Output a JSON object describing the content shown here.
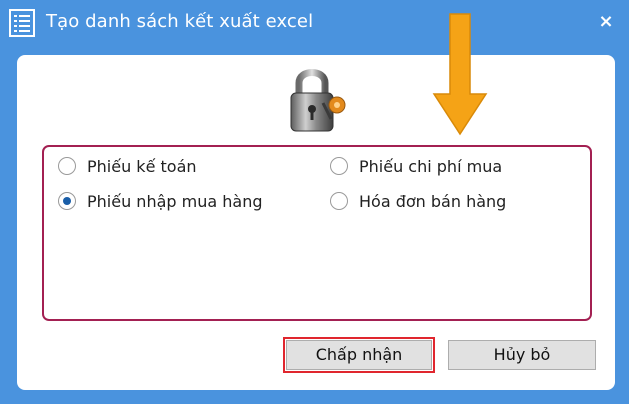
{
  "window": {
    "title": "Tạo danh sách kết xuất excel",
    "title_icon": "list-document-icon",
    "close_glyph": "×",
    "close_icon": "close-icon",
    "colors": {
      "titlebar": "#4a93de",
      "panel": "#ffffff",
      "options_border": "#a32052",
      "highlight": "#e0262e",
      "arrow": "#f5a316"
    }
  },
  "header_icon": "padlock-icon",
  "options": [
    {
      "label": "Phiếu kế toán",
      "selected": false
    },
    {
      "label": "Phiếu chi phí mua",
      "selected": false
    },
    {
      "label": "Phiếu nhập mua hàng",
      "selected": true
    },
    {
      "label": "Hóa đơn bán hàng",
      "selected": false
    }
  ],
  "buttons": {
    "accept_label": "Chấp nhận",
    "cancel_label": "Hủy bỏ"
  },
  "annotation": {
    "icon": "down-arrow-icon"
  }
}
